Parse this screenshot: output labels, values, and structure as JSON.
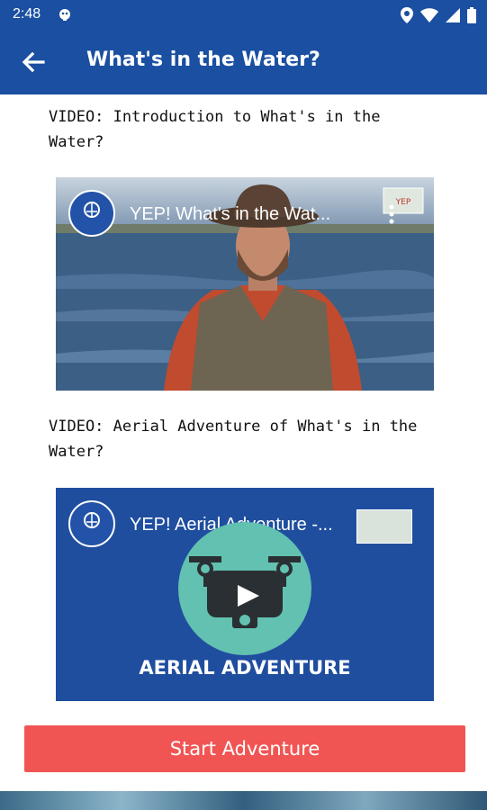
{
  "status": {
    "time": "2:48"
  },
  "appbar": {
    "title": "What's in the Water?"
  },
  "videos": [
    {
      "label": "VIDEO: Introduction to What's in the Water?",
      "title": "YEP! What's in the Wat..."
    },
    {
      "label": "VIDEO: Aerial Adventure of What's in the Water?",
      "title": "YEP! Aerial Adventure -...",
      "caption": "AERIAL ADVENTURE"
    }
  ],
  "button": {
    "label": "Start Adventure"
  }
}
